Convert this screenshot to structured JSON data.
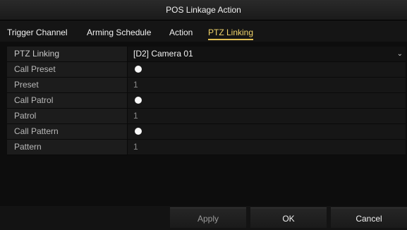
{
  "window": {
    "title": "POS Linkage Action"
  },
  "tabs": [
    {
      "label": "Trigger Channel"
    },
    {
      "label": "Arming Schedule"
    },
    {
      "label": "Action"
    },
    {
      "label": "PTZ Linking"
    }
  ],
  "active_tab": "PTZ Linking",
  "fields": {
    "ptz_linking": {
      "label": "PTZ Linking",
      "value": "[D2] Camera 01"
    },
    "call_preset": {
      "label": "Call Preset",
      "checked": true
    },
    "preset": {
      "label": "Preset",
      "value": "1"
    },
    "call_patrol": {
      "label": "Call Patrol",
      "checked": true
    },
    "patrol": {
      "label": "Patrol",
      "value": "1"
    },
    "call_pattern": {
      "label": "Call Pattern",
      "checked": true
    },
    "pattern": {
      "label": "Pattern",
      "value": "1"
    }
  },
  "buttons": {
    "apply": "Apply",
    "ok": "OK",
    "cancel": "Cancel"
  },
  "icons": {
    "dropdown": "chevron-down-icon",
    "radio": "radio-dot-icon"
  }
}
